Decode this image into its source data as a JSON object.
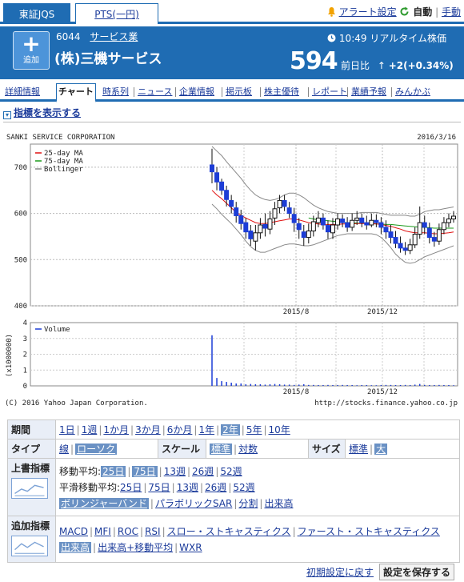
{
  "tabs": {
    "tse": "東証JQS",
    "pts": "PTS(一円)"
  },
  "top_links": {
    "alert": "アラート設定",
    "auto": "自動",
    "manual": "手動"
  },
  "stock": {
    "add_label": "追加",
    "code": "6044",
    "sector": "サービス業",
    "name": "(株)三機サービス",
    "time": "10:49",
    "rt_label": "リアルタイム株価",
    "price": "594",
    "change_label": "前日比",
    "change": "+2(+0.34%)"
  },
  "nav": [
    "詳細情報",
    "チャート",
    "時系列",
    "ニュース",
    "企業情報",
    "掲示板",
    "株主優待",
    "レポート",
    "業績予報",
    "みんかぶ"
  ],
  "show_indicators": "指標を表示する",
  "chart_data": {
    "type": "candlestick",
    "title": "SANKI SERVICE CORPORATION",
    "date": "2016/3/16",
    "legend": [
      "25-day MA",
      "75-day MA",
      "Bollinger"
    ],
    "series_colors": {
      "up": "#ffffff",
      "down": "#1c3dd6",
      "ma25": "#e01010",
      "ma75": "#1a9a1a",
      "bollinger": "#888888",
      "volume": "#1c3dd6"
    },
    "y_ticks": [
      700,
      600,
      500,
      400
    ],
    "ylim": [
      400,
      750
    ],
    "x_ticks": [
      "2015/8",
      "2015/12"
    ],
    "volume_label": "Volume",
    "volume_unit": "(x1000000)",
    "volume_ticks": [
      4,
      3,
      2,
      1,
      0
    ],
    "volume_ylim": [
      0,
      4
    ],
    "copyright": "(C) 2016 Yahoo Japan Corporation.",
    "source_url": "http://stocks.finance.yahoo.co.jp",
    "candles": [
      [
        705,
        690,
        740,
        665
      ],
      [
        688,
        668,
        700,
        650
      ],
      [
        668,
        650,
        675,
        640
      ],
      [
        650,
        630,
        660,
        615
      ],
      [
        628,
        615,
        640,
        600
      ],
      [
        612,
        595,
        625,
        580
      ],
      [
        595,
        578,
        608,
        565
      ],
      [
        580,
        560,
        590,
        545
      ],
      [
        562,
        545,
        575,
        530
      ],
      [
        540,
        558,
        575,
        520
      ],
      [
        558,
        575,
        590,
        545
      ],
      [
        576,
        568,
        600,
        550
      ],
      [
        566,
        588,
        605,
        555
      ],
      [
        590,
        610,
        625,
        575
      ],
      [
        612,
        628,
        640,
        600
      ],
      [
        628,
        615,
        640,
        605
      ],
      [
        612,
        600,
        625,
        590
      ],
      [
        598,
        580,
        612,
        560
      ],
      [
        578,
        565,
        590,
        545
      ],
      [
        560,
        548,
        575,
        530
      ],
      [
        548,
        562,
        578,
        535
      ],
      [
        562,
        582,
        595,
        550
      ],
      [
        580,
        590,
        605,
        570
      ],
      [
        590,
        575,
        600,
        565
      ],
      [
        574,
        560,
        585,
        545
      ],
      [
        558,
        575,
        590,
        545
      ],
      [
        575,
        588,
        600,
        565
      ],
      [
        588,
        580,
        598,
        570
      ],
      [
        580,
        570,
        592,
        560
      ],
      [
        570,
        585,
        600,
        562
      ],
      [
        585,
        590,
        605,
        575
      ],
      [
        590,
        580,
        600,
        570
      ],
      [
        580,
        575,
        595,
        565
      ],
      [
        575,
        585,
        600,
        570
      ],
      [
        585,
        580,
        598,
        570
      ],
      [
        580,
        570,
        592,
        555
      ],
      [
        570,
        560,
        585,
        545
      ],
      [
        560,
        548,
        575,
        535
      ],
      [
        548,
        535,
        562,
        525
      ],
      [
        535,
        525,
        550,
        515
      ],
      [
        525,
        520,
        538,
        510
      ],
      [
        520,
        532,
        545,
        512
      ],
      [
        532,
        555,
        570,
        525
      ],
      [
        555,
        580,
        615,
        545
      ],
      [
        580,
        570,
        595,
        555
      ],
      [
        568,
        548,
        580,
        535
      ],
      [
        548,
        540,
        560,
        528
      ],
      [
        540,
        565,
        578,
        532
      ],
      [
        565,
        580,
        592,
        555
      ],
      [
        580,
        588,
        600,
        570
      ],
      [
        588,
        594,
        605,
        580
      ]
    ],
    "ma25": [
      650,
      640,
      632,
      622,
      612,
      602,
      596,
      590,
      585,
      580,
      578,
      578,
      580,
      582,
      584,
      586,
      588,
      588,
      586,
      583,
      580,
      578,
      577,
      576,
      576,
      576,
      576,
      577,
      577,
      577,
      578,
      578,
      578,
      578,
      577,
      576,
      574,
      572,
      569,
      566,
      562,
      560,
      558,
      558,
      558,
      557,
      556,
      556,
      557,
      558,
      560
    ],
    "ma75": [
      null,
      null,
      null,
      null,
      null,
      null,
      null,
      null,
      null,
      null,
      null,
      null,
      null,
      null,
      null,
      null,
      null,
      null,
      null,
      null,
      590,
      588,
      586,
      585,
      584,
      583,
      582,
      581,
      580,
      580,
      579,
      579,
      578,
      578,
      577,
      577,
      576,
      576,
      575,
      574,
      573,
      572,
      571,
      570,
      570,
      569,
      568,
      568,
      568,
      568,
      568
    ],
    "boll_upper": [
      745,
      735,
      725,
      712,
      700,
      688,
      676,
      662,
      650,
      640,
      634,
      630,
      628,
      630,
      634,
      640,
      644,
      644,
      640,
      634,
      626,
      618,
      612,
      608,
      604,
      602,
      600,
      600,
      600,
      600,
      600,
      602,
      602,
      602,
      602,
      600,
      598,
      596,
      596,
      596,
      596,
      594,
      594,
      598,
      604,
      606,
      608,
      608,
      610,
      612,
      614
    ],
    "boll_lower": [
      620,
      610,
      598,
      588,
      578,
      566,
      554,
      540,
      528,
      520,
      516,
      516,
      520,
      524,
      528,
      532,
      534,
      534,
      532,
      530,
      530,
      532,
      536,
      540,
      544,
      548,
      552,
      554,
      556,
      556,
      556,
      556,
      556,
      556,
      554,
      548,
      538,
      526,
      512,
      502,
      494,
      492,
      494,
      500,
      506,
      510,
      514,
      518,
      522,
      526,
      530
    ],
    "volume": [
      3.2,
      0.5,
      0.3,
      0.25,
      0.2,
      0.15,
      0.15,
      0.1,
      0.12,
      0.1,
      0.1,
      0.08,
      0.1,
      0.12,
      0.1,
      0.08,
      0.08,
      0.06,
      0.08,
      0.1,
      0.06,
      0.06,
      0.05,
      0.05,
      0.06,
      0.05,
      0.05,
      0.06,
      0.05,
      0.05,
      0.04,
      0.05,
      0.05,
      0.04,
      0.04,
      0.05,
      0.06,
      0.06,
      0.05,
      0.05,
      0.06,
      0.05,
      0.08,
      0.12,
      0.06,
      0.05,
      0.05,
      0.06,
      0.05,
      0.05,
      0.04
    ]
  },
  "controls": {
    "period": {
      "label": "期間",
      "items": [
        "1日",
        "1週",
        "1か月",
        "3か月",
        "6か月",
        "1年",
        "2年",
        "5年",
        "10年"
      ],
      "selected": "2年"
    },
    "type": {
      "label": "タイプ",
      "items": [
        "線",
        "ローソク"
      ],
      "selected": "ローソク"
    },
    "scale": {
      "label": "スケール",
      "items": [
        "標準",
        "対数"
      ],
      "selected": "標準"
    },
    "size": {
      "label": "サイズ",
      "items": [
        "標準",
        "大"
      ],
      "selected": "大"
    },
    "overlay": {
      "label": "上書指標",
      "ma_label": "移動平均:",
      "ma_items": [
        "25日",
        "75日",
        "13週",
        "26週",
        "52週"
      ],
      "ma_selected": [
        "25日",
        "75日"
      ],
      "smooth_label": "平滑移動平均:",
      "smooth_items": [
        "25日",
        "75日",
        "13週",
        "26週",
        "52週"
      ],
      "others": [
        "ボリンジャーバンド",
        "パラボリックSAR",
        "分割",
        "出来高"
      ],
      "others_selected": [
        "ボリンジャーバンド"
      ]
    },
    "extra": {
      "label": "追加指標",
      "items": [
        "MACD",
        "MFI",
        "ROC",
        "RSI",
        "スロー・ストキャスティクス",
        "ファースト・ストキャスティクス"
      ],
      "items2": [
        "出来高",
        "出来高+移動平均",
        "WXR"
      ],
      "selected": [
        "出来高"
      ]
    }
  },
  "bottom": {
    "reset": "初期設定に戻す",
    "save": "設定を保存する"
  }
}
